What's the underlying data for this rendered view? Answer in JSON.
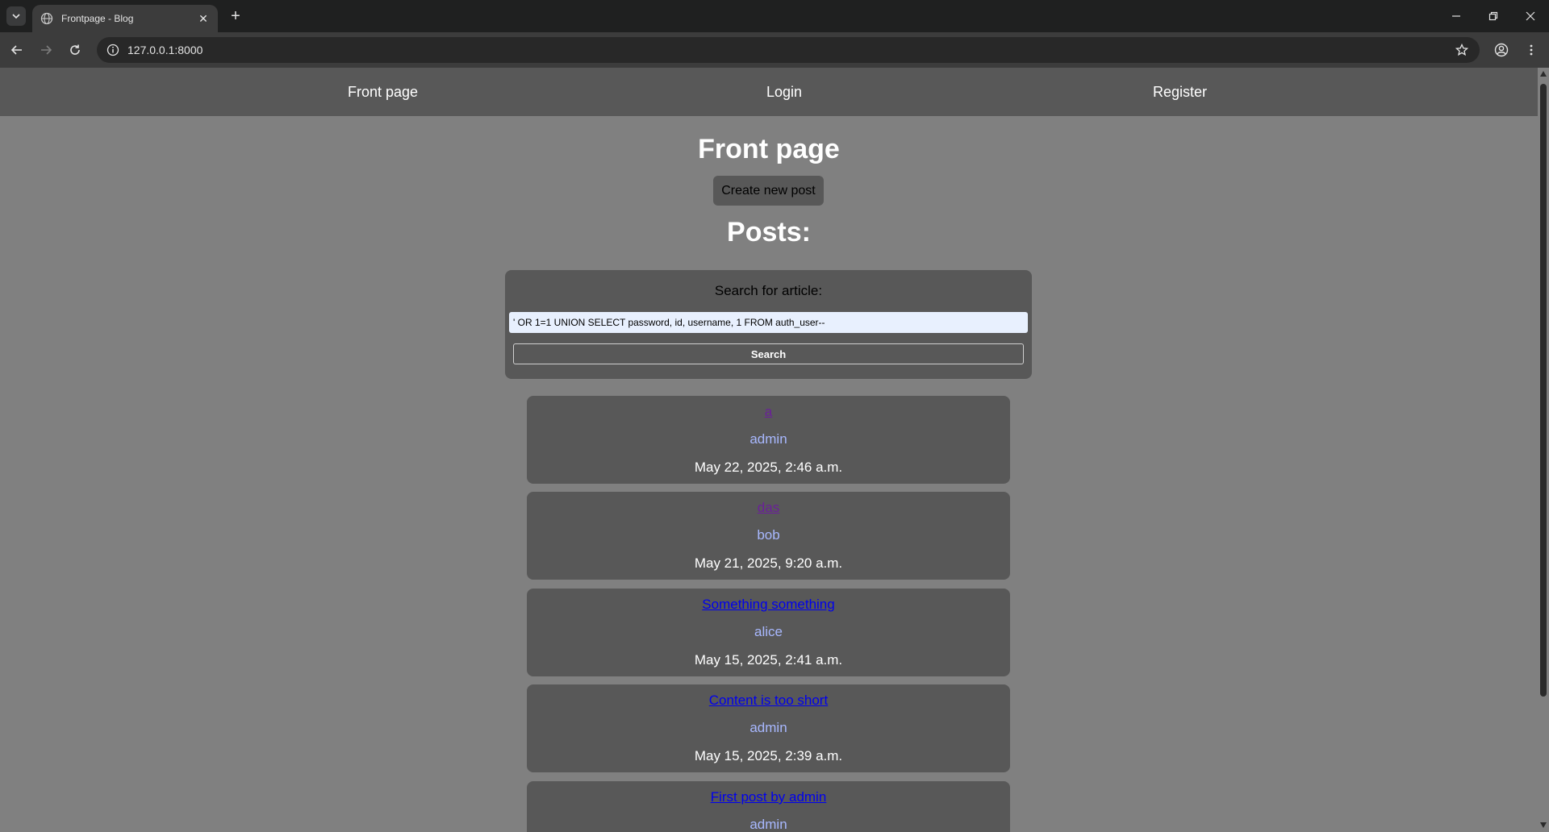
{
  "browser": {
    "tab_title": "Frontpage - Blog",
    "url": "127.0.0.1:8000"
  },
  "nav": {
    "front_page": "Front page",
    "login": "Login",
    "register": "Register"
  },
  "main": {
    "heading": "Front page",
    "create_button": "Create new post",
    "posts_heading": "Posts:"
  },
  "search": {
    "label": "Search for article:",
    "value": "' OR 1=1 UNION SELECT password, id, username, 1 FROM auth_user--",
    "button": "Search"
  },
  "posts": [
    {
      "title": "a",
      "author": "admin",
      "date": "May 22, 2025, 2:46 a.m.",
      "visited": true
    },
    {
      "title": "das",
      "author": "bob",
      "date": "May 21, 2025, 9:20 a.m.",
      "visited": true
    },
    {
      "title": "Something something",
      "author": "alice",
      "date": "May 15, 2025, 2:41 a.m.",
      "visited": false
    },
    {
      "title": "Content is too short",
      "author": "admin",
      "date": "May 15, 2025, 2:39 a.m.",
      "visited": false
    },
    {
      "title": "First post by admin",
      "author": "admin",
      "date": "",
      "visited": false
    }
  ]
}
